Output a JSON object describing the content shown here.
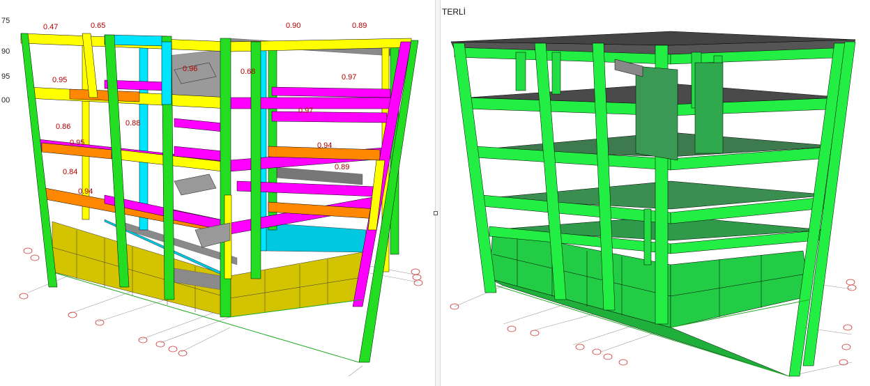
{
  "left_view": {
    "margin_labels": [
      "75",
      "90",
      "95",
      "00"
    ],
    "ratio_labels": [
      "0.47",
      "0.65",
      "0.90",
      "0.95",
      "0.97",
      "0.86",
      "0.95",
      "0.94",
      "0.84",
      "0.94",
      "0.89",
      "0.88",
      "0.96",
      "0.68",
      "0.97",
      "0.89"
    ],
    "member_colors": {
      "column_green": "#22dd22",
      "beam_yellow": "#ffff00",
      "beam_magenta": "#ff00ff",
      "beam_orange": "#ff8800",
      "column_cyan": "#00e5ff",
      "slab_yellow": "#d4c400",
      "slab_cyan": "#00c8e0",
      "mesh_gray": "#888888",
      "label_red": "#b00000"
    }
  },
  "right_view": {
    "title": "TERLİ",
    "member_colors": {
      "frame_green": "#22ee44",
      "wall_green": "#22cc44",
      "deck_gray": "#555555",
      "edge_black": "#000000"
    }
  }
}
